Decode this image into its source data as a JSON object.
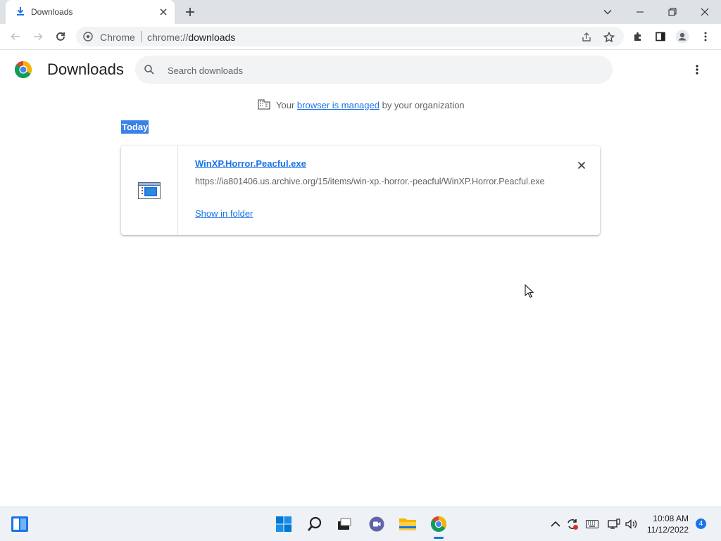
{
  "tab": {
    "title": "Downloads",
    "icon": "download-icon"
  },
  "omnibox": {
    "site": "Chrome",
    "url_scheme": "chrome://",
    "url_host": "downloads"
  },
  "page": {
    "title": "Downloads",
    "search_placeholder": "Search downloads"
  },
  "managed": {
    "prefix": "Your",
    "link": "browser is managed",
    "suffix": "by your organization"
  },
  "section": {
    "date": "Today"
  },
  "download": {
    "file_name": "WinXP.Horror.Peacful.exe",
    "url": "https://ia801406.us.archive.org/15/items/win-xp.-horror.-peacful/WinXP.Horror.Peacful.exe",
    "show_in_folder": "Show in folder"
  },
  "taskbar": {
    "time": "10:08 AM",
    "date": "11/12/2022",
    "notification_count": "4"
  },
  "colors": {
    "accent": "#1a73e8",
    "selection": "#3b82e6",
    "tabstrip": "#dee1e6"
  }
}
